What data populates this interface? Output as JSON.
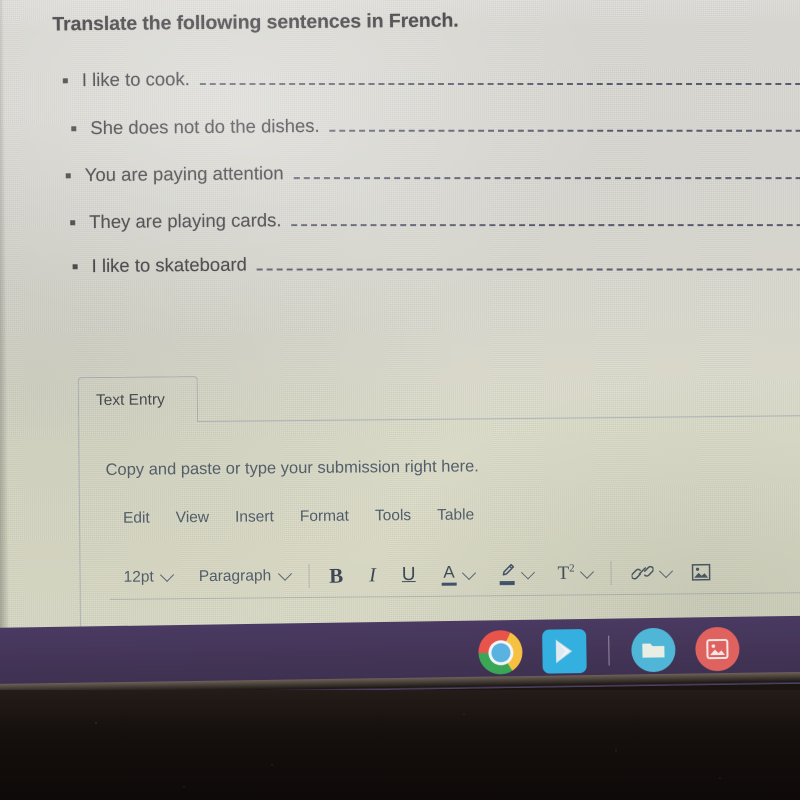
{
  "worksheet": {
    "title": "Translate the following sentences in French.",
    "items": [
      {
        "text": "I like to cook."
      },
      {
        "text": "She does not do the dishes."
      },
      {
        "text": "You are paying attention"
      },
      {
        "text": "They are playing cards."
      },
      {
        "text": "I like to skateboard"
      }
    ]
  },
  "entry_panel": {
    "tab_label": "Text Entry",
    "placeholder": "Copy and paste or type your submission right here.",
    "menu": [
      "Edit",
      "View",
      "Insert",
      "Format",
      "Tools",
      "Table"
    ],
    "toolbar": {
      "font_size": "12pt",
      "block_format": "Paragraph",
      "bold": "B",
      "italic": "I",
      "underline": "U",
      "text_color": "A",
      "highlight_color": "pencil",
      "superscript": "T",
      "superscript_exponent": "2",
      "link": "link",
      "image": "image"
    }
  },
  "dock": {
    "items": [
      {
        "name": "Chrome"
      },
      {
        "name": "Play Store"
      },
      {
        "name": "Files"
      },
      {
        "name": "Gallery"
      }
    ]
  },
  "colors": {
    "screen_background": "#d9d8d1",
    "screen_background_lower": "#dcdcc7",
    "title_text": "#39373a",
    "body_text": "#36343a",
    "blank_line": "#4c4d64",
    "panel_border": "#aeb5ba",
    "editor_text": "#4c5966",
    "dock_background": "#443558",
    "desk": "#150f0d"
  }
}
